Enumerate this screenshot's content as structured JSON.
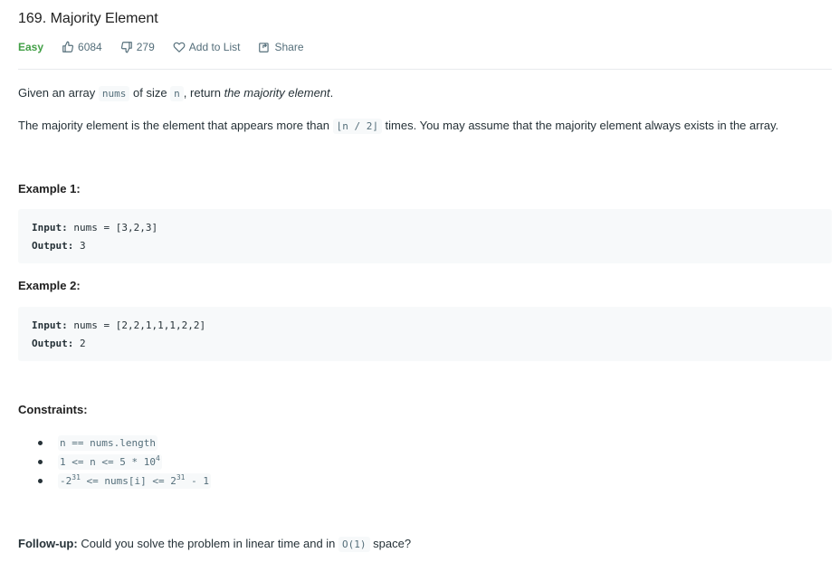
{
  "problem": {
    "title": "169. Majority Element",
    "difficulty": "Easy",
    "likes": "6084",
    "dislikes": "279",
    "add_to_list_label": "Add to List",
    "share_label": "Share"
  },
  "description": {
    "p1_pre": "Given an array ",
    "p1_code1": "nums",
    "p1_mid": " of size ",
    "p1_code2": "n",
    "p1_post": ", return ",
    "p1_em": "the majority element",
    "p1_end": ".",
    "p2_pre": "The majority element is the element that appears more than ",
    "p2_code": "⌊n / 2⌋",
    "p2_post": " times. You may assume that the majority element always exists in the array."
  },
  "examples": [
    {
      "title": "Example 1:",
      "input_label": "Input:",
      "input_value": "nums = [3,2,3]",
      "output_label": "Output:",
      "output_value": "3"
    },
    {
      "title": "Example 2:",
      "input_label": "Input:",
      "input_value": "nums = [2,2,1,1,1,2,2]",
      "output_label": "Output:",
      "output_value": "2"
    }
  ],
  "constraints": {
    "title": "Constraints:",
    "c1": "n == nums.length",
    "c2_pre": "1 <= n <= 5 * 10",
    "c2_sup": "4",
    "c3_a": "-2",
    "c3_sup1": "31",
    "c3_b": " <= nums[i] <= 2",
    "c3_sup2": "31",
    "c3_c": " - 1"
  },
  "followup": {
    "label": "Follow-up:",
    "text_pre": " Could you solve the problem in linear time and in ",
    "code": "O(1)",
    "text_post": " space?"
  },
  "colors": {
    "easy": "#43a047",
    "text": "#263238",
    "muted": "#546e7a",
    "code_bg": "#f7f9fa"
  }
}
